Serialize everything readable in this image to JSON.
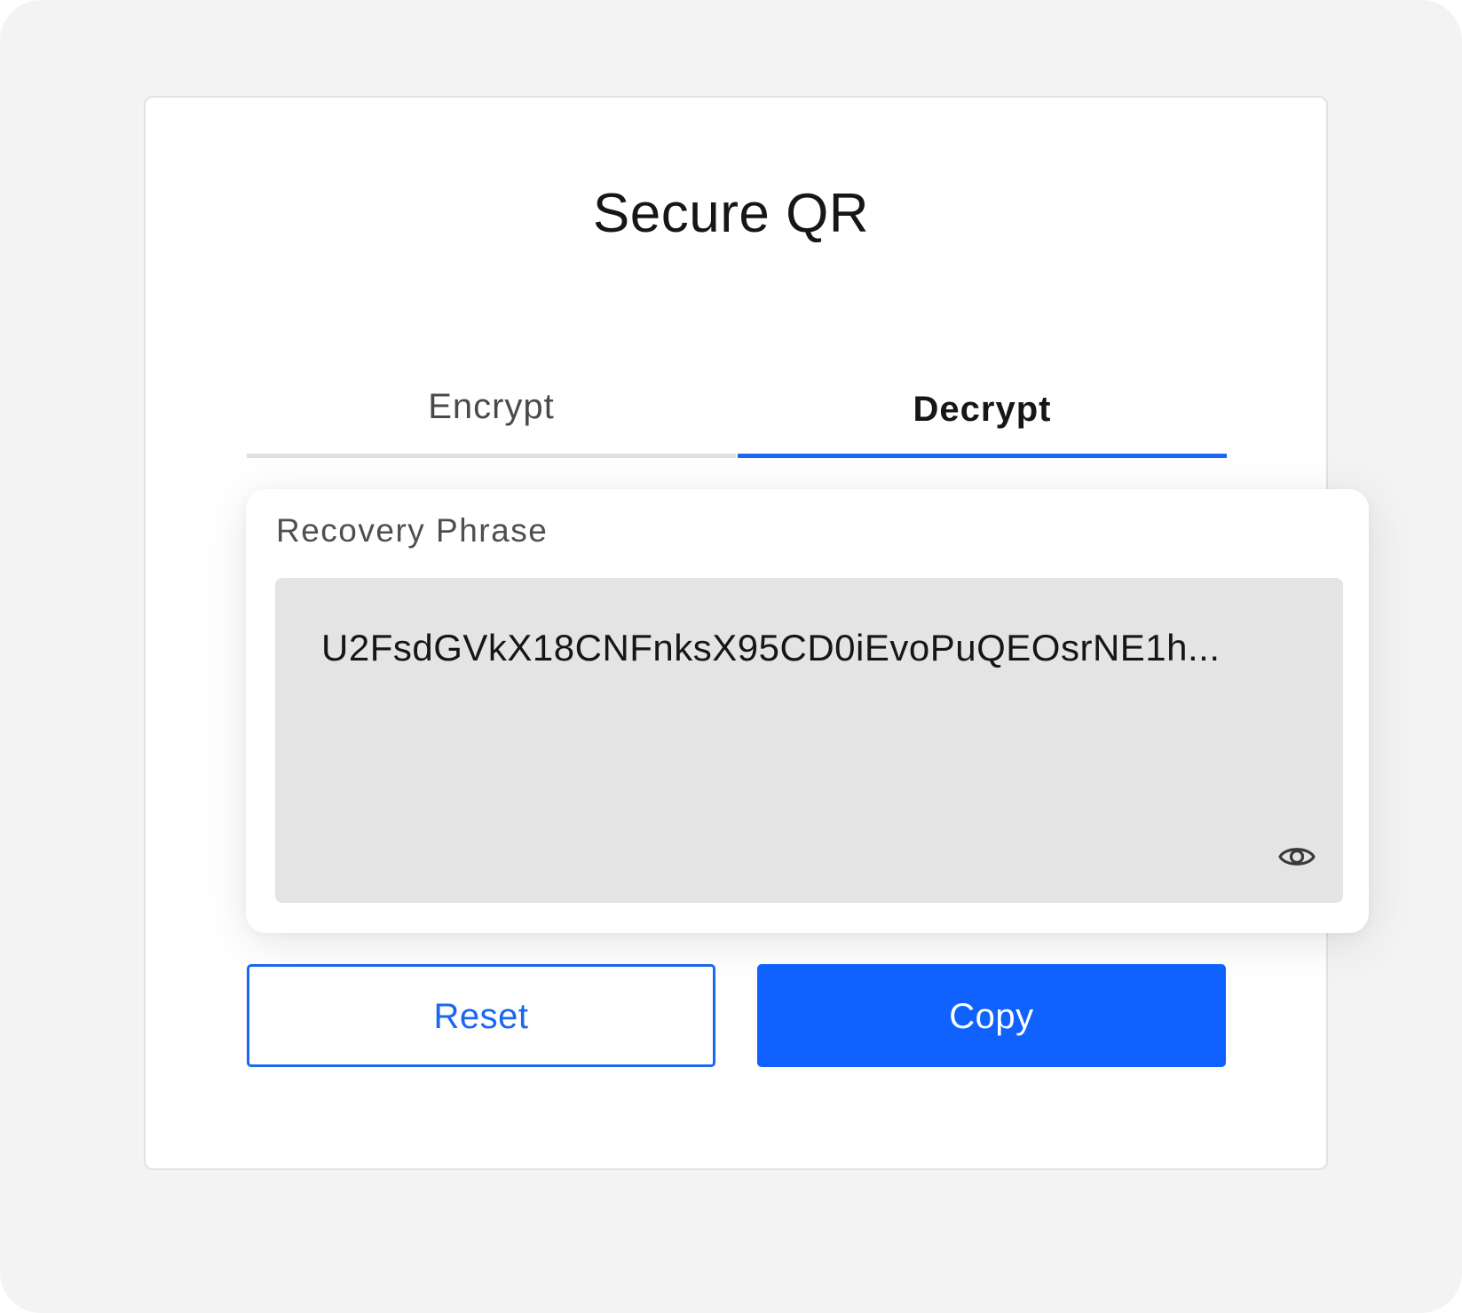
{
  "app": {
    "title": "Secure QR"
  },
  "tabs": [
    {
      "label": "Encrypt",
      "active": false
    },
    {
      "label": "Decrypt",
      "active": true
    }
  ],
  "recovery": {
    "label": "Recovery Phrase",
    "value": "U2FsdGVkX18CNFnksX95CD0iEvoPuQEOsrNE1h...",
    "visibility_icon": "eye-icon"
  },
  "actions": {
    "reset_label": "Reset",
    "copy_label": "Copy"
  },
  "colors": {
    "accent": "#0f62fe",
    "background": "#f3f3f3",
    "field_background": "#e4e4e4",
    "inactive_tab_underline": "#e0e0e0"
  }
}
